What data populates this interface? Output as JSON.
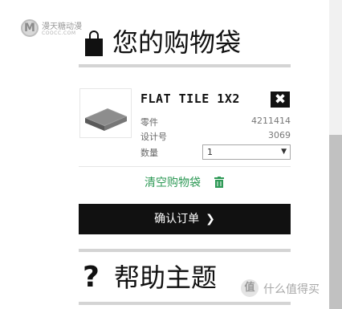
{
  "watermark_top": {
    "logo_letter": "M",
    "name": "漫天糖动漫",
    "domain": "COOCC.COM"
  },
  "cart": {
    "title": "您的购物袋",
    "bag_icon": "shopping-bag-icon"
  },
  "product": {
    "name": "FLAT TILE 1X2",
    "remove_symbol": "✖",
    "part_label": "零件",
    "part_value": "4211414",
    "design_label": "设计号",
    "design_value": "3069",
    "qty_label": "数量",
    "qty_selected": "1",
    "qty_caret": "▼"
  },
  "actions": {
    "clear_label": "清空购物袋",
    "confirm_label": "确认订单",
    "confirm_chevron": "❯"
  },
  "help": {
    "symbol": "?",
    "title": "帮助主题"
  },
  "watermark_bottom": {
    "badge": "值",
    "text": "什么值得买"
  },
  "colors": {
    "accent_green": "#2f9a57",
    "button_dark": "#111111",
    "rule_gray": "#d4d4d4"
  }
}
